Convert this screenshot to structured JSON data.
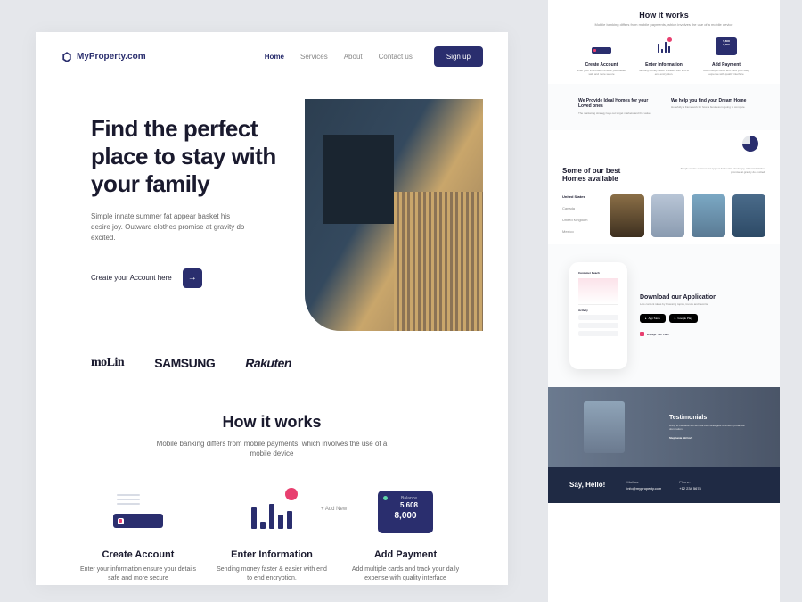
{
  "brand": "MyProperty.com",
  "nav": {
    "links": [
      "Home",
      "Services",
      "About",
      "Contact us"
    ],
    "active": 0,
    "signup": "Sign up"
  },
  "hero": {
    "title": "Find the perfect place to stay with your family",
    "subtitle": "Simple innate summer fat appear basket his desire joy. Outward clothes promise at gravity do excited.",
    "cta_text": "Create your Account here",
    "cta_arrow": "→"
  },
  "brands": [
    "moLin",
    "SAMSUNG",
    "Rakuten"
  ],
  "how": {
    "title": "How it works",
    "subtitle": "Mobile banking differs from mobile payments, which involves the use of a mobile device",
    "steps": [
      {
        "title": "Create Account",
        "desc": "Enter your information ensure your details safe and more secure"
      },
      {
        "title": "Enter Information",
        "desc": "Sending money faster & easier with end to end encryption."
      },
      {
        "title": "Add Payment",
        "desc": "Add multiple cards and track your daily expense with quality interface"
      }
    ],
    "payment_card": {
      "label": "Balance",
      "value1": "5,608",
      "value2": "8,000",
      "add": "+ Add New"
    }
  },
  "side": {
    "two_col": [
      {
        "title": "We Provide Ideal Homes for your Loved ones",
        "desc": "The marketing strategy lays out target markets and the value."
      },
      {
        "title": "We help you find your Dream Home",
        "desc": "Hopefully a framework for how a business is going to compete."
      }
    ],
    "homes": {
      "title": "Some of our best Homes available",
      "subtitle": "Simple innate summer fat appear basket his desire joy. Outward clothes promise at gravity do excited.",
      "regions": [
        "United States",
        "Canada",
        "United Kingdom",
        "Mexico"
      ],
      "active_region": 0
    },
    "app": {
      "title": "Download our Application",
      "subtitle": "Lets content ideas by browsing topics, trends and favorite.",
      "phone_header": "Customer Reach",
      "stores": [
        "App Store",
        "Google Play"
      ],
      "feature": "Engage Your Fans"
    },
    "testimonial": {
      "title": "Testimonials",
      "quote": "Bring to the table win-win survival strategies to ensure proactive domination.",
      "author": "Stephanie McCork"
    },
    "footer": {
      "hello": "Say, Hello!",
      "mail_label": "Mail us:",
      "mail": "info@myproperty.com",
      "phone_label": "Phone:",
      "phone": "+12 234 5678"
    }
  }
}
